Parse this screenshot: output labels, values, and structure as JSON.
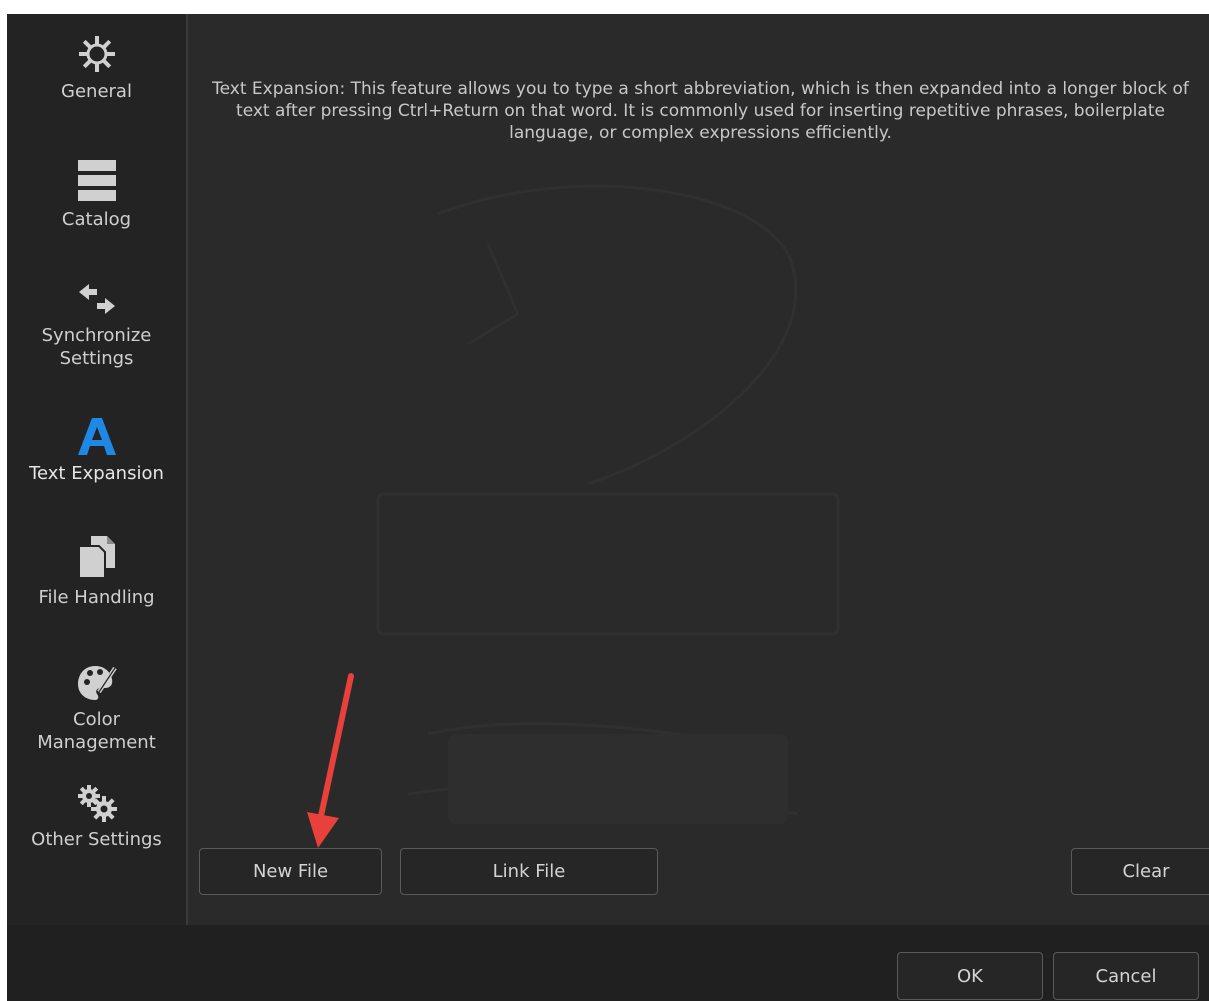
{
  "sidebar": {
    "items": [
      {
        "label": "General",
        "icon": "gear-icon"
      },
      {
        "label": "Catalog",
        "icon": "catalog-icon"
      },
      {
        "label": "Synchronize\nSettings",
        "icon": "sync-arrows-icon"
      },
      {
        "label": "Text Expansion",
        "icon": "text-a-icon",
        "active": true
      },
      {
        "label": "File Handling",
        "icon": "files-icon"
      },
      {
        "label": "Color\nManagement",
        "icon": "palette-icon"
      },
      {
        "label": "Other Settings",
        "icon": "gears-icon"
      }
    ]
  },
  "main": {
    "description": "Text Expansion: This feature allows you to type a short abbreviation, which is then expanded into a longer block of text after pressing Ctrl+Return on that word. It is commonly used for inserting repetitive phrases, boilerplate language, or complex expressions efficiently.",
    "buttons": {
      "new_file": "New File",
      "link_file": "Link File",
      "clear": "Clear"
    }
  },
  "footer": {
    "ok": "OK",
    "cancel": "Cancel"
  },
  "colors": {
    "accent_blue": "#1e88e5",
    "annotation_red": "#e8403a",
    "background": "#2b2b2b",
    "sidebar": "#232323"
  }
}
